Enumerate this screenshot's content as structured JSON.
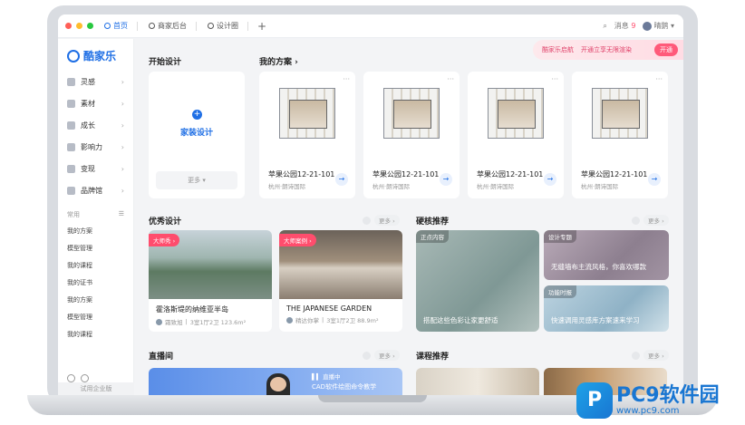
{
  "window": {
    "tabs": [
      {
        "label": "首页",
        "icon": "home-icon",
        "active": true
      },
      {
        "label": "商家后台",
        "icon": "store-icon",
        "active": false
      },
      {
        "label": "设计圈",
        "icon": "circle-icon",
        "active": false
      }
    ],
    "new_tab": "+",
    "messages": "消息",
    "message_count": "9",
    "username": "晴鹅"
  },
  "promo": {
    "brand": "酷家乐启航",
    "text": "开通立享无限渲染",
    "button": "开通"
  },
  "sidebar": {
    "logo": "酷家乐",
    "items": [
      {
        "label": "灵感",
        "icon": "diamond-icon"
      },
      {
        "label": "素材",
        "icon": "cube-icon"
      },
      {
        "label": "成长",
        "icon": "growth-icon"
      },
      {
        "label": "影响力",
        "icon": "influence-icon"
      },
      {
        "label": "变现",
        "icon": "money-icon"
      },
      {
        "label": "品牌馆",
        "icon": "brand-icon"
      }
    ],
    "common_label": "常用",
    "common_items": [
      "我的方案",
      "模型管理",
      "我的课程",
      "我的证书",
      "我的方案",
      "模型管理",
      "我的课程"
    ],
    "trial": "试用企业版"
  },
  "start": {
    "title": "开始设计",
    "label": "家装设计",
    "more": "更多"
  },
  "plans": {
    "title": "我的方案",
    "items": [
      {
        "name": "苹果公园12-21-101",
        "location": "杭州·朗诗国际"
      },
      {
        "name": "苹果公园12-21-101",
        "location": "杭州·朗诗国际"
      },
      {
        "name": "苹果公园12-21-101",
        "location": "杭州·朗诗国际"
      },
      {
        "name": "苹果公园12-21-101",
        "location": "杭州·朗诗国际"
      }
    ]
  },
  "excellent": {
    "title": "优秀设计",
    "more": "更多",
    "items": [
      {
        "badge": "大师秀",
        "name": "霍洛斯堤的纳维亚半岛",
        "author": "霜致旭",
        "meta": "3室1厅2卫 123.6m²"
      },
      {
        "badge": "大师案例",
        "name": "THE JAPANESE GARDEN",
        "author": "精达你掌",
        "meta": "3室1厅2卫 88.9m²"
      }
    ]
  },
  "hardcore": {
    "title": "硬核推荐",
    "more": "更多",
    "items": [
      {
        "tag": "正点内容",
        "caption": "搭配这些色彩让家更舒适"
      },
      {
        "tag": "设计专题",
        "caption": "无缝墙布主流风格，你喜欢哪款"
      },
      {
        "tag": "功能时报",
        "caption": "快速调用灵感库方案速来学习"
      }
    ]
  },
  "live": {
    "title": "直播间",
    "more": "更多",
    "status": "直播中",
    "desc": "CAD软件绘图命令教学"
  },
  "courses": {
    "title": "课程推荐",
    "more": "更多"
  },
  "watermark": {
    "logo_letter": "P",
    "name": "PC9软件园",
    "url": "www.pc9.com"
  },
  "colors": {
    "accent": "#1f6fe5",
    "badge": "#ff4d6d",
    "promo": "#ff5a7a"
  }
}
